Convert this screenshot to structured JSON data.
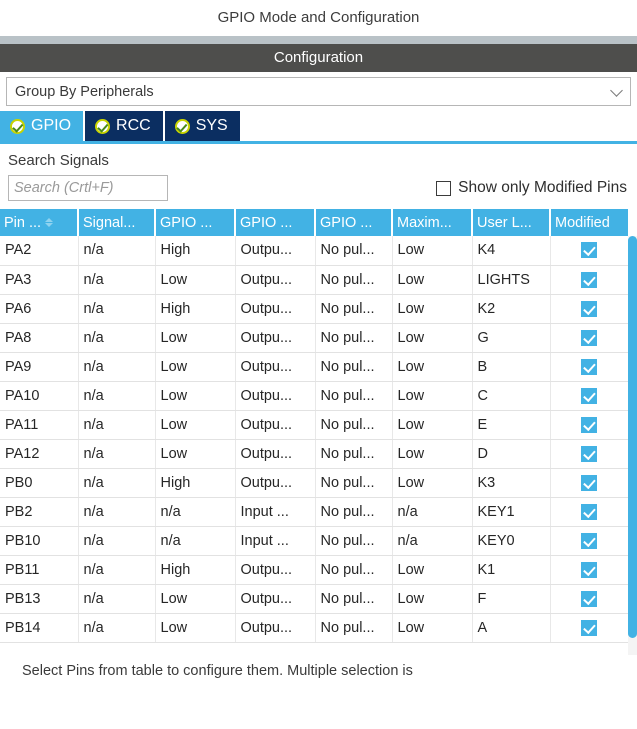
{
  "window": {
    "title": "GPIO Mode and Configuration",
    "section_bar": "Configuration"
  },
  "grouping": {
    "selected": "Group By Peripherals",
    "chevron_icon": "chevron-down-icon"
  },
  "tabs": [
    {
      "label": "GPIO",
      "active": true,
      "status_icon": "check-circle-icon"
    },
    {
      "label": "RCC",
      "active": false,
      "status_icon": "check-circle-icon"
    },
    {
      "label": "SYS",
      "active": false,
      "status_icon": "check-circle-icon"
    }
  ],
  "search": {
    "label": "Search Signals",
    "placeholder": "Search (Crtl+F)",
    "value": ""
  },
  "filter": {
    "show_only_modified_label": "Show only Modified Pins",
    "checked": false
  },
  "table": {
    "columns": [
      {
        "label": "Pin ...",
        "sorted": true
      },
      {
        "label": "Signal...",
        "sorted": false
      },
      {
        "label": "GPIO ...",
        "sorted": false
      },
      {
        "label": "GPIO ...",
        "sorted": false
      },
      {
        "label": "GPIO ...",
        "sorted": false
      },
      {
        "label": "Maxim...",
        "sorted": false
      },
      {
        "label": "User L...",
        "sorted": false
      },
      {
        "label": "Modified",
        "sorted": false
      }
    ],
    "rows": [
      {
        "pin": "PA2",
        "signal": "n/a",
        "output_level": "High",
        "mode": "Outpu...",
        "pull": "No pul...",
        "speed": "Low",
        "user_label": "K4",
        "modified": true
      },
      {
        "pin": "PA3",
        "signal": "n/a",
        "output_level": "Low",
        "mode": "Outpu...",
        "pull": "No pul...",
        "speed": "Low",
        "user_label": "LIGHTS",
        "modified": true
      },
      {
        "pin": "PA6",
        "signal": "n/a",
        "output_level": "High",
        "mode": "Outpu...",
        "pull": "No pul...",
        "speed": "Low",
        "user_label": "K2",
        "modified": true
      },
      {
        "pin": "PA8",
        "signal": "n/a",
        "output_level": "Low",
        "mode": "Outpu...",
        "pull": "No pul...",
        "speed": "Low",
        "user_label": "G",
        "modified": true
      },
      {
        "pin": "PA9",
        "signal": "n/a",
        "output_level": "Low",
        "mode": "Outpu...",
        "pull": "No pul...",
        "speed": "Low",
        "user_label": "B",
        "modified": true
      },
      {
        "pin": "PA10",
        "signal": "n/a",
        "output_level": "Low",
        "mode": "Outpu...",
        "pull": "No pul...",
        "speed": "Low",
        "user_label": "C",
        "modified": true
      },
      {
        "pin": "PA11",
        "signal": "n/a",
        "output_level": "Low",
        "mode": "Outpu...",
        "pull": "No pul...",
        "speed": "Low",
        "user_label": "E",
        "modified": true
      },
      {
        "pin": "PA12",
        "signal": "n/a",
        "output_level": "Low",
        "mode": "Outpu...",
        "pull": "No pul...",
        "speed": "Low",
        "user_label": "D",
        "modified": true
      },
      {
        "pin": "PB0",
        "signal": "n/a",
        "output_level": "High",
        "mode": "Outpu...",
        "pull": "No pul...",
        "speed": "Low",
        "user_label": "K3",
        "modified": true
      },
      {
        "pin": "PB2",
        "signal": "n/a",
        "output_level": "n/a",
        "mode": "Input ...",
        "pull": "No pul...",
        "speed": "n/a",
        "user_label": "KEY1",
        "modified": true
      },
      {
        "pin": "PB10",
        "signal": "n/a",
        "output_level": "n/a",
        "mode": "Input ...",
        "pull": "No pul...",
        "speed": "n/a",
        "user_label": "KEY0",
        "modified": true
      },
      {
        "pin": "PB11",
        "signal": "n/a",
        "output_level": "High",
        "mode": "Outpu...",
        "pull": "No pul...",
        "speed": "Low",
        "user_label": "K1",
        "modified": true
      },
      {
        "pin": "PB13",
        "signal": "n/a",
        "output_level": "Low",
        "mode": "Outpu...",
        "pull": "No pul...",
        "speed": "Low",
        "user_label": "F",
        "modified": true
      },
      {
        "pin": "PB14",
        "signal": "n/a",
        "output_level": "Low",
        "mode": "Outpu...",
        "pull": "No pul...",
        "speed": "Low",
        "user_label": "A",
        "modified": true
      }
    ]
  },
  "footer": {
    "hint": "Select Pins from table to configure them. Multiple selection is"
  },
  "colors": {
    "accent_blue": "#42b2e4",
    "tab_inactive": "#0b2e61",
    "config_bar": "#4e4e4c",
    "strip": "#b9c2c7",
    "check_ring": "#c8d400"
  }
}
